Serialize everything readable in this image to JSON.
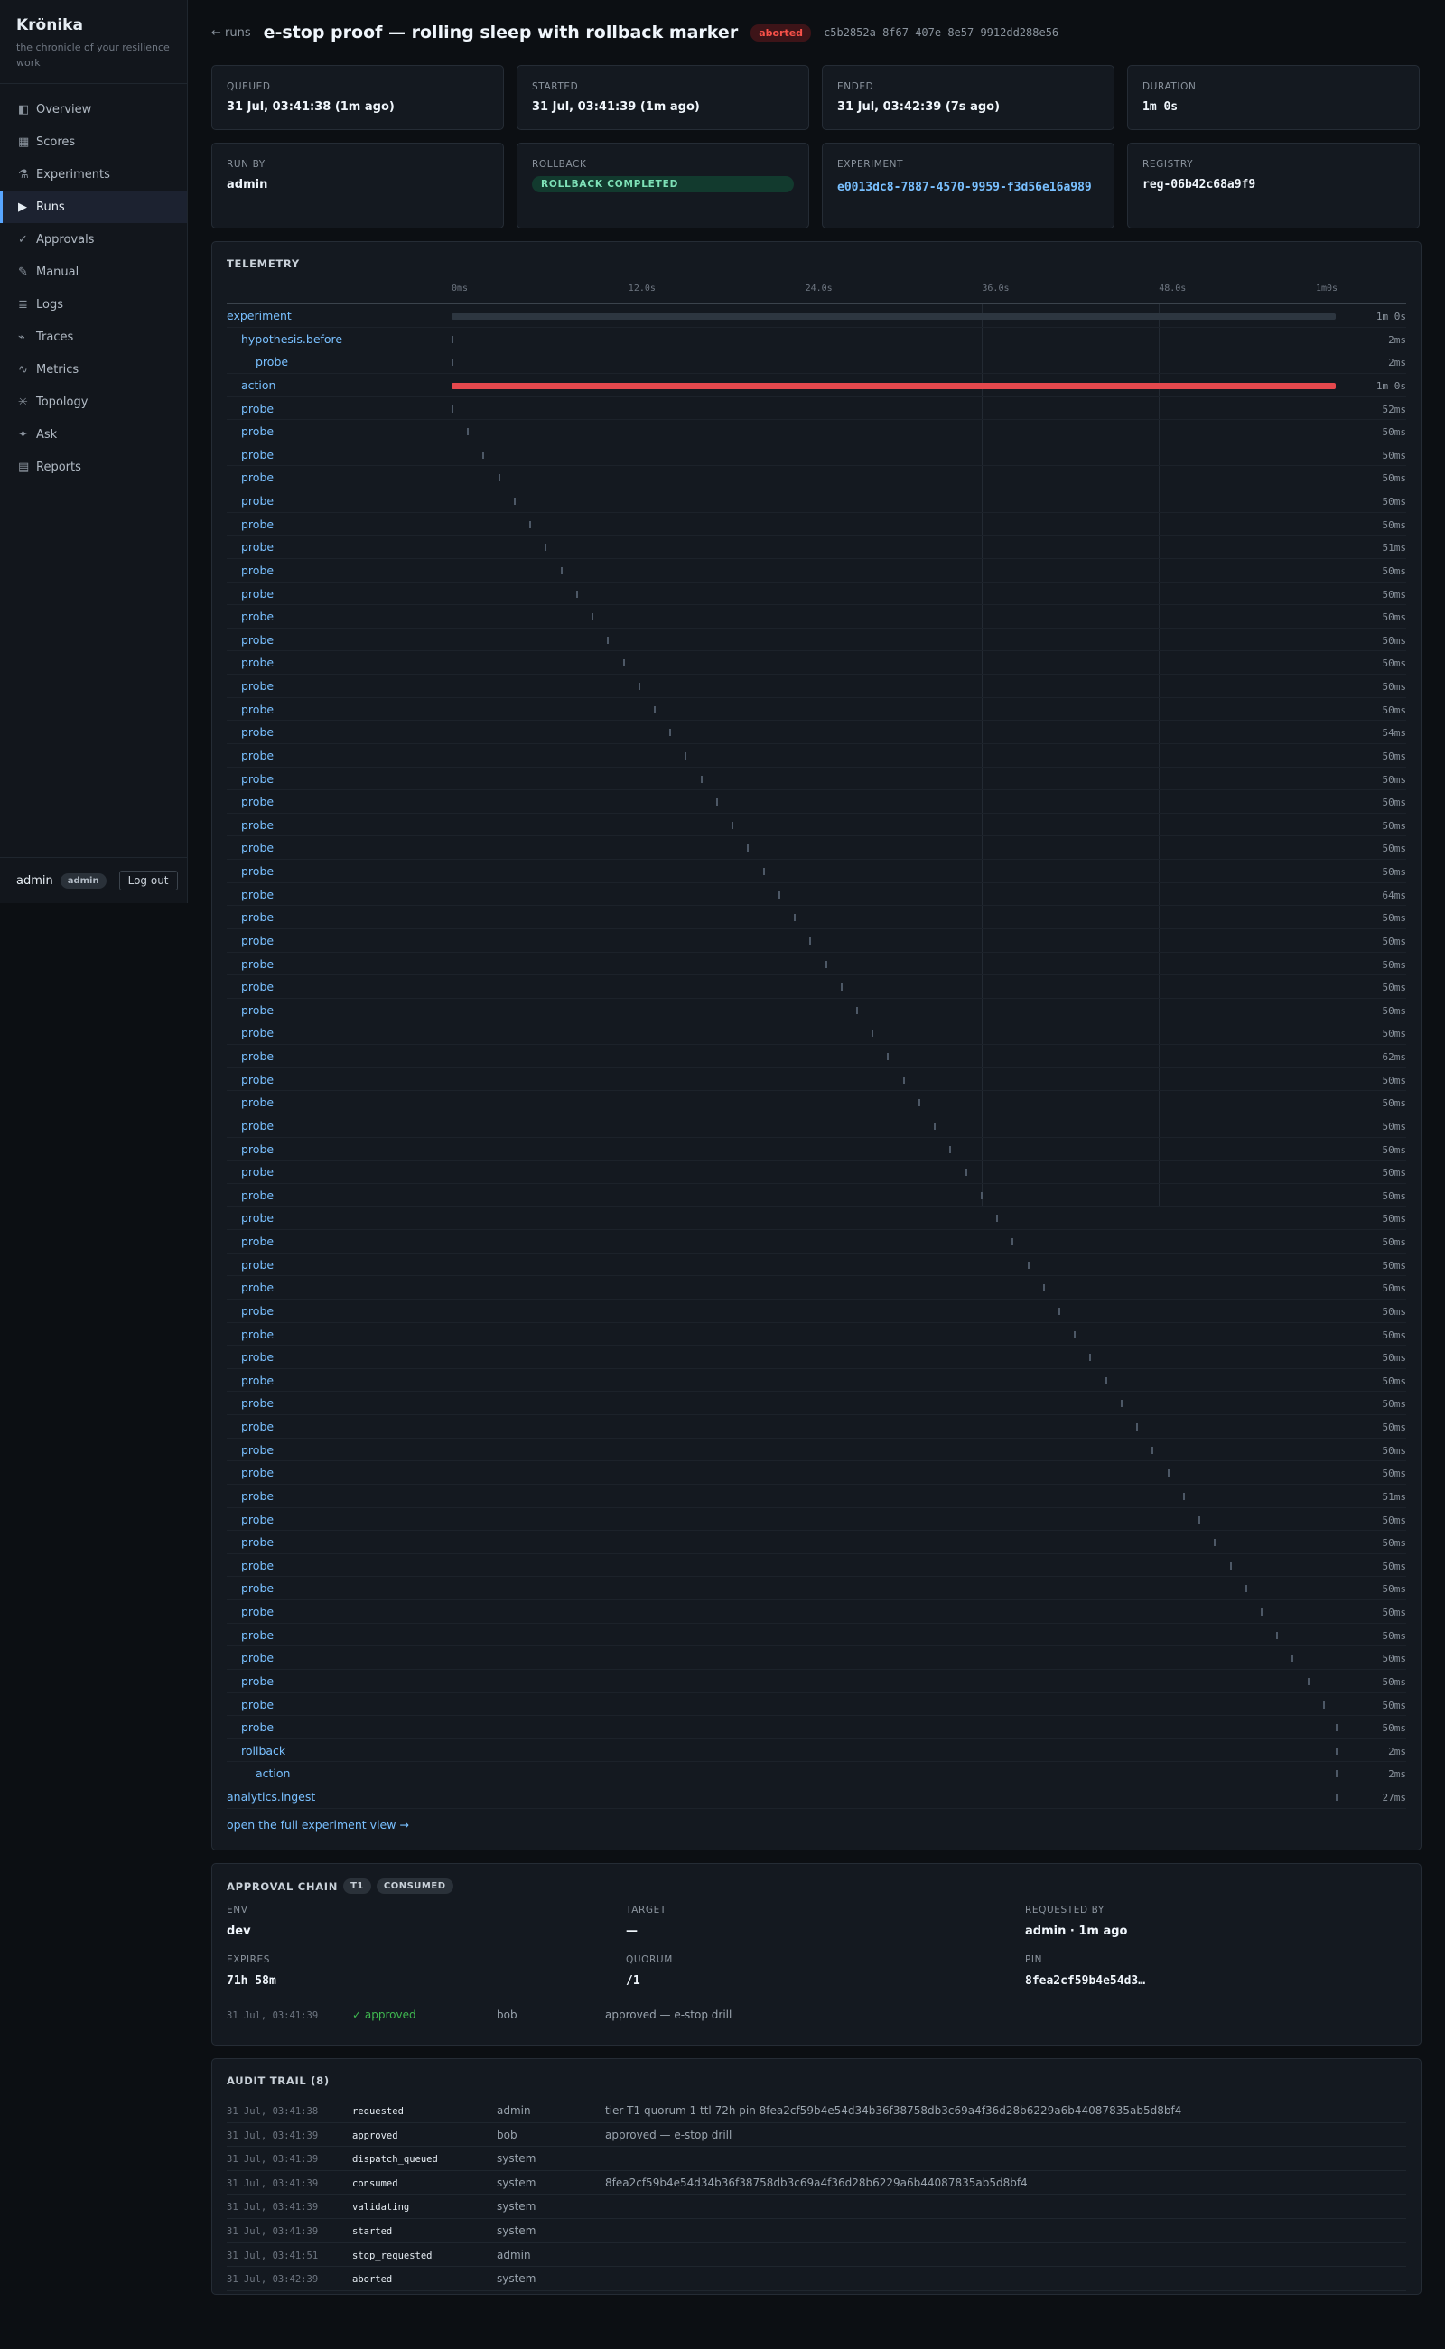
{
  "sidebar": {
    "brand": "Krönika",
    "tagline": "the chronicle of your resilience work",
    "nav": [
      {
        "label": "Overview",
        "icon": "overview-icon",
        "glyph": "◧"
      },
      {
        "label": "Scores",
        "icon": "scores-icon",
        "glyph": "▦"
      },
      {
        "label": "Experiments",
        "icon": "flask-icon",
        "glyph": "⚗"
      },
      {
        "label": "Runs",
        "icon": "play-icon",
        "glyph": "▶",
        "active": true
      },
      {
        "label": "Approvals",
        "icon": "check-icon",
        "glyph": "✓"
      },
      {
        "label": "Manual",
        "icon": "pencil-icon",
        "glyph": "✎"
      },
      {
        "label": "Logs",
        "icon": "logs-icon",
        "glyph": "≣"
      },
      {
        "label": "Traces",
        "icon": "traces-icon",
        "glyph": "⌁"
      },
      {
        "label": "Metrics",
        "icon": "metrics-icon",
        "glyph": "∿"
      },
      {
        "label": "Topology",
        "icon": "topology-icon",
        "glyph": "✳"
      },
      {
        "label": "Ask",
        "icon": "sparkle-icon",
        "glyph": "✦"
      },
      {
        "label": "Reports",
        "icon": "reports-icon",
        "glyph": "▤"
      }
    ],
    "user": "admin",
    "role": "admin",
    "logout": "Log out"
  },
  "header": {
    "back": "← runs",
    "title": "e-stop proof — rolling sleep with rollback marker",
    "status": "aborted",
    "run_id": "c5b2852a-8f67-407e-8e57-9912dd288e56"
  },
  "cards": {
    "queued": {
      "label": "Queued",
      "value": "31 Jul, 03:41:38 (1m ago)"
    },
    "started": {
      "label": "Started",
      "value": "31 Jul, 03:41:39 (1m ago)"
    },
    "ended": {
      "label": "Ended",
      "value": "31 Jul, 03:42:39 (7s ago)"
    },
    "duration": {
      "label": "Duration",
      "value": "1m 0s"
    },
    "run_by": {
      "label": "Run by",
      "value": "admin"
    },
    "rollback": {
      "label": "Rollback",
      "value": "ROLLBACK COMPLETED"
    },
    "experiment": {
      "label": "Experiment",
      "value": "e0013dc8-7887-4570-9959-f3d56e16a989"
    },
    "registry": {
      "label": "Registry",
      "value": "reg-06b42c68a9f9"
    }
  },
  "telemetry": {
    "title": "Telemetry",
    "ticks": [
      "0ms",
      "12.0s",
      "24.0s",
      "36.0s",
      "48.0s",
      "1m0s"
    ],
    "full_link": "open the full experiment view →",
    "colors": {
      "experiment": "#2d3640",
      "action": "#e5484d",
      "tick": "#4d5866"
    },
    "spans": [
      {
        "name": "experiment",
        "depth": 0,
        "start": 0,
        "end": 1.0,
        "duration": "1m 0s",
        "style": "dim"
      },
      {
        "name": "hypothesis.before",
        "depth": 1,
        "start": 0,
        "end": 0,
        "duration": "2ms",
        "style": "tick"
      },
      {
        "name": "probe",
        "depth": 2,
        "start": 0,
        "end": 0,
        "duration": "2ms",
        "style": "tick"
      },
      {
        "name": "action",
        "depth": 1,
        "start": 0,
        "end": 1.0,
        "duration": "1m 0s",
        "style": "red"
      },
      {
        "name": "probe",
        "depth": 1,
        "start": 0.0,
        "end": 0.0,
        "duration": "52ms",
        "style": "tick"
      },
      {
        "name": "probe",
        "depth": 1,
        "start": 0.0176,
        "end": 0.0176,
        "duration": "50ms",
        "style": "tick"
      },
      {
        "name": "probe",
        "depth": 1,
        "start": 0.0352,
        "end": 0.0352,
        "duration": "50ms",
        "style": "tick"
      },
      {
        "name": "probe",
        "depth": 1,
        "start": 0.0528,
        "end": 0.0528,
        "duration": "50ms",
        "style": "tick"
      },
      {
        "name": "probe",
        "depth": 1,
        "start": 0.0704,
        "end": 0.0704,
        "duration": "50ms",
        "style": "tick"
      },
      {
        "name": "probe",
        "depth": 1,
        "start": 0.088,
        "end": 0.088,
        "duration": "50ms",
        "style": "tick"
      },
      {
        "name": "probe",
        "depth": 1,
        "start": 0.1056,
        "end": 0.1056,
        "duration": "51ms",
        "style": "tick"
      },
      {
        "name": "probe",
        "depth": 1,
        "start": 0.1232,
        "end": 0.1232,
        "duration": "50ms",
        "style": "tick"
      },
      {
        "name": "probe",
        "depth": 1,
        "start": 0.1408,
        "end": 0.1408,
        "duration": "50ms",
        "style": "tick"
      },
      {
        "name": "probe",
        "depth": 1,
        "start": 0.1584,
        "end": 0.1584,
        "duration": "50ms",
        "style": "tick"
      },
      {
        "name": "probe",
        "depth": 1,
        "start": 0.176,
        "end": 0.176,
        "duration": "50ms",
        "style": "tick"
      },
      {
        "name": "probe",
        "depth": 1,
        "start": 0.1936,
        "end": 0.1936,
        "duration": "50ms",
        "style": "tick"
      },
      {
        "name": "probe",
        "depth": 1,
        "start": 0.2112,
        "end": 0.2112,
        "duration": "50ms",
        "style": "tick"
      },
      {
        "name": "probe",
        "depth": 1,
        "start": 0.2288,
        "end": 0.2288,
        "duration": "50ms",
        "style": "tick"
      },
      {
        "name": "probe",
        "depth": 1,
        "start": 0.2464,
        "end": 0.2464,
        "duration": "54ms",
        "style": "tick"
      },
      {
        "name": "probe",
        "depth": 1,
        "start": 0.264,
        "end": 0.264,
        "duration": "50ms",
        "style": "tick"
      },
      {
        "name": "probe",
        "depth": 1,
        "start": 0.2816,
        "end": 0.2816,
        "duration": "50ms",
        "style": "tick"
      },
      {
        "name": "probe",
        "depth": 1,
        "start": 0.2992,
        "end": 0.2992,
        "duration": "50ms",
        "style": "tick"
      },
      {
        "name": "probe",
        "depth": 1,
        "start": 0.3168,
        "end": 0.3168,
        "duration": "50ms",
        "style": "tick"
      },
      {
        "name": "probe",
        "depth": 1,
        "start": 0.3344,
        "end": 0.3344,
        "duration": "50ms",
        "style": "tick"
      },
      {
        "name": "probe",
        "depth": 1,
        "start": 0.352,
        "end": 0.352,
        "duration": "50ms",
        "style": "tick"
      },
      {
        "name": "probe",
        "depth": 1,
        "start": 0.3696,
        "end": 0.3696,
        "duration": "64ms",
        "style": "tick"
      },
      {
        "name": "probe",
        "depth": 1,
        "start": 0.3872,
        "end": 0.3872,
        "duration": "50ms",
        "style": "tick"
      },
      {
        "name": "probe",
        "depth": 1,
        "start": 0.4048,
        "end": 0.4048,
        "duration": "50ms",
        "style": "tick"
      },
      {
        "name": "probe",
        "depth": 1,
        "start": 0.4224,
        "end": 0.4224,
        "duration": "50ms",
        "style": "tick"
      },
      {
        "name": "probe",
        "depth": 1,
        "start": 0.44,
        "end": 0.44,
        "duration": "50ms",
        "style": "tick"
      },
      {
        "name": "probe",
        "depth": 1,
        "start": 0.4576,
        "end": 0.4576,
        "duration": "50ms",
        "style": "tick"
      },
      {
        "name": "probe",
        "depth": 1,
        "start": 0.4752,
        "end": 0.4752,
        "duration": "50ms",
        "style": "tick"
      },
      {
        "name": "probe",
        "depth": 1,
        "start": 0.4928,
        "end": 0.4928,
        "duration": "62ms",
        "style": "tick"
      },
      {
        "name": "probe",
        "depth": 1,
        "start": 0.5104,
        "end": 0.5104,
        "duration": "50ms",
        "style": "tick"
      },
      {
        "name": "probe",
        "depth": 1,
        "start": 0.528,
        "end": 0.528,
        "duration": "50ms",
        "style": "tick"
      },
      {
        "name": "probe",
        "depth": 1,
        "start": 0.5456,
        "end": 0.5456,
        "duration": "50ms",
        "style": "tick"
      },
      {
        "name": "probe",
        "depth": 1,
        "start": 0.5632,
        "end": 0.5632,
        "duration": "50ms",
        "style": "tick"
      },
      {
        "name": "probe",
        "depth": 1,
        "start": 0.5808,
        "end": 0.5808,
        "duration": "50ms",
        "style": "tick"
      },
      {
        "name": "probe",
        "depth": 1,
        "start": 0.5984,
        "end": 0.5984,
        "duration": "50ms",
        "style": "tick"
      },
      {
        "name": "probe",
        "depth": 1,
        "start": 0.616,
        "end": 0.616,
        "duration": "50ms",
        "style": "tick"
      },
      {
        "name": "probe",
        "depth": 1,
        "start": 0.6336,
        "end": 0.6336,
        "duration": "50ms",
        "style": "tick"
      },
      {
        "name": "probe",
        "depth": 1,
        "start": 0.6512,
        "end": 0.6512,
        "duration": "50ms",
        "style": "tick"
      },
      {
        "name": "probe",
        "depth": 1,
        "start": 0.6688,
        "end": 0.6688,
        "duration": "50ms",
        "style": "tick"
      },
      {
        "name": "probe",
        "depth": 1,
        "start": 0.6864,
        "end": 0.6864,
        "duration": "50ms",
        "style": "tick"
      },
      {
        "name": "probe",
        "depth": 1,
        "start": 0.704,
        "end": 0.704,
        "duration": "50ms",
        "style": "tick"
      },
      {
        "name": "probe",
        "depth": 1,
        "start": 0.7216,
        "end": 0.7216,
        "duration": "50ms",
        "style": "tick"
      },
      {
        "name": "probe",
        "depth": 1,
        "start": 0.7392,
        "end": 0.7392,
        "duration": "50ms",
        "style": "tick"
      },
      {
        "name": "probe",
        "depth": 1,
        "start": 0.7568,
        "end": 0.7568,
        "duration": "50ms",
        "style": "tick"
      },
      {
        "name": "probe",
        "depth": 1,
        "start": 0.7744,
        "end": 0.7744,
        "duration": "50ms",
        "style": "tick"
      },
      {
        "name": "probe",
        "depth": 1,
        "start": 0.792,
        "end": 0.792,
        "duration": "50ms",
        "style": "tick"
      },
      {
        "name": "probe",
        "depth": 1,
        "start": 0.8096,
        "end": 0.8096,
        "duration": "50ms",
        "style": "tick"
      },
      {
        "name": "probe",
        "depth": 1,
        "start": 0.8272,
        "end": 0.8272,
        "duration": "51ms",
        "style": "tick"
      },
      {
        "name": "probe",
        "depth": 1,
        "start": 0.8448,
        "end": 0.8448,
        "duration": "50ms",
        "style": "tick"
      },
      {
        "name": "probe",
        "depth": 1,
        "start": 0.8624,
        "end": 0.8624,
        "duration": "50ms",
        "style": "tick"
      },
      {
        "name": "probe",
        "depth": 1,
        "start": 0.88,
        "end": 0.88,
        "duration": "50ms",
        "style": "tick"
      },
      {
        "name": "probe",
        "depth": 1,
        "start": 0.8976,
        "end": 0.8976,
        "duration": "50ms",
        "style": "tick"
      },
      {
        "name": "probe",
        "depth": 1,
        "start": 0.9152,
        "end": 0.9152,
        "duration": "50ms",
        "style": "tick"
      },
      {
        "name": "probe",
        "depth": 1,
        "start": 0.9328,
        "end": 0.9328,
        "duration": "50ms",
        "style": "tick"
      },
      {
        "name": "probe",
        "depth": 1,
        "start": 0.9504,
        "end": 0.9504,
        "duration": "50ms",
        "style": "tick"
      },
      {
        "name": "probe",
        "depth": 1,
        "start": 0.968,
        "end": 0.968,
        "duration": "50ms",
        "style": "tick"
      },
      {
        "name": "probe",
        "depth": 1,
        "start": 0.9856,
        "end": 0.9856,
        "duration": "50ms",
        "style": "tick"
      },
      {
        "name": "probe",
        "depth": 1,
        "start": 0.9995,
        "end": 0.9995,
        "duration": "50ms",
        "style": "tick"
      },
      {
        "name": "rollback",
        "depth": 1,
        "start": 1.0,
        "end": 1.0,
        "duration": "2ms",
        "style": "tick"
      },
      {
        "name": "action",
        "depth": 2,
        "start": 1.0,
        "end": 1.0,
        "duration": "2ms",
        "style": "tick"
      },
      {
        "name": "analytics.ingest",
        "depth": 0,
        "start": 1.0,
        "end": 1.0,
        "duration": "27ms",
        "style": "tick"
      }
    ]
  },
  "approval": {
    "title": "Approval chain",
    "tier": "T1",
    "state": "CONSUMED",
    "fields": [
      {
        "label": "Env",
        "value": "dev",
        "mono": false
      },
      {
        "label": "Target",
        "value": "—",
        "mono": false
      },
      {
        "label": "Requested by",
        "value": "admin · 1m ago",
        "mono": false
      },
      {
        "label": "Expires",
        "value": "71h 58m",
        "mono": true
      },
      {
        "label": "Quorum",
        "value": "/1",
        "mono": true
      },
      {
        "label": "Pin",
        "value": "8fea2cf59b4e54d3…",
        "mono": true
      }
    ],
    "entry": {
      "ts": "31 Jul, 03:41:39",
      "status": "✓ approved",
      "actor": "bob",
      "note": "approved — e-stop drill"
    }
  },
  "audit": {
    "title": "Audit trail (8)",
    "rows": [
      {
        "ts": "31 Jul, 03:41:38",
        "event": "requested",
        "actor": "admin",
        "detail": "tier T1 quorum 1 ttl 72h pin 8fea2cf59b4e54d34b36f38758db3c69a4f36d28b6229a6b44087835ab5d8bf4"
      },
      {
        "ts": "31 Jul, 03:41:39",
        "event": "approved",
        "actor": "bob",
        "detail": "approved — e-stop drill"
      },
      {
        "ts": "31 Jul, 03:41:39",
        "event": "dispatch_queued",
        "actor": "system",
        "detail": ""
      },
      {
        "ts": "31 Jul, 03:41:39",
        "event": "consumed",
        "actor": "system",
        "detail": "8fea2cf59b4e54d34b36f38758db3c69a4f36d28b6229a6b44087835ab5d8bf4"
      },
      {
        "ts": "31 Jul, 03:41:39",
        "event": "validating",
        "actor": "system",
        "detail": ""
      },
      {
        "ts": "31 Jul, 03:41:39",
        "event": "started",
        "actor": "system",
        "detail": ""
      },
      {
        "ts": "31 Jul, 03:41:51",
        "event": "stop_requested",
        "actor": "admin",
        "detail": ""
      },
      {
        "ts": "31 Jul, 03:42:39",
        "event": "aborted",
        "actor": "system",
        "detail": ""
      }
    ]
  }
}
